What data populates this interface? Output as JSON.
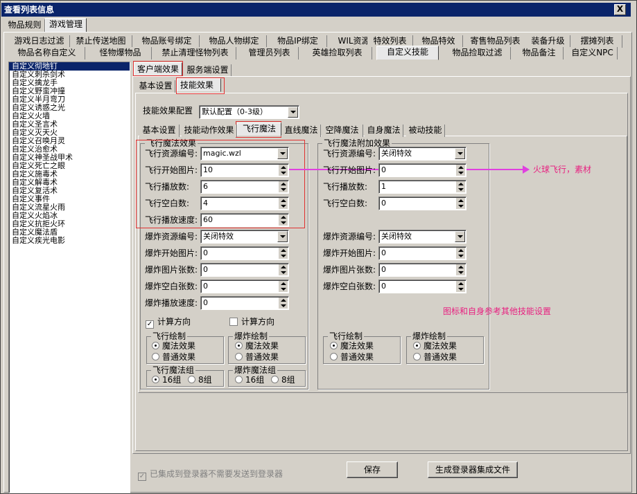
{
  "window": {
    "title": "查看列表信息",
    "close": "X"
  },
  "top_tabs": [
    "物品规则",
    "游戏管理"
  ],
  "tabs_row1": [
    "游戏日志过滤",
    "禁止传送地图",
    "物品账号绑定",
    "物品人物绑定",
    "物品IP绑定",
    "WIL资源",
    "特效列表",
    "物品特效",
    "寄售物品列表",
    "装备升级",
    "摆摊列表"
  ],
  "tabs_row2": [
    "物品名称自定义",
    "怪物爆物品",
    "禁止清理怪物列表",
    "管理员列表",
    "英雄捡取列表",
    "自定义技能",
    "物品捡取过滤",
    "物品备注",
    "自定义NPC"
  ],
  "skill_list": [
    "自定义彻地钉",
    "自定义刺杀剑术",
    "自定义擒龙手",
    "自定义野蛮冲撞",
    "自定义半月弯刀",
    "自定义诱惑之光",
    "自定义火墙",
    "自定义圣言术",
    "自定义灭天火",
    "自定义召唤月灵",
    "自定义治愈术",
    "自定义神圣战甲术",
    "自定义死亡之眼",
    "自定义施毒术",
    "自定义解毒术",
    "自定义复活术",
    "自定义事件",
    "自定义流星火雨",
    "自定义火焰冰",
    "自定义抗拒火环",
    "自定义魔法盾",
    "自定义疾光电影"
  ],
  "client_tabs": [
    "客户端效果",
    "服务端设置"
  ],
  "sub_tabs": [
    "基本设置",
    "技能效果"
  ],
  "config": {
    "label": "技能效果配置",
    "value": "默认配置（0-3级）"
  },
  "magic_tabs": [
    "基本设置",
    "技能动作效果",
    "飞行魔法",
    "直线魔法",
    "空降魔法",
    "自身魔法",
    "被动技能"
  ],
  "left": {
    "title": "飞行魔法效果",
    "fields": [
      {
        "label": "飞行资源编号:",
        "value": "magic.wzl",
        "kind": "combo"
      },
      {
        "label": "飞行开始图片:",
        "value": "10",
        "kind": "spin"
      },
      {
        "label": "飞行播放数:",
        "value": "6",
        "kind": "spin"
      },
      {
        "label": "飞行空白数:",
        "value": "4",
        "kind": "spin"
      },
      {
        "label": "飞行播放速度:",
        "value": "60",
        "kind": "spin"
      },
      {
        "label": "爆炸资源编号:",
        "value": "关闭特效",
        "kind": "combo"
      },
      {
        "label": "爆炸开始图片:",
        "value": "0",
        "kind": "spin"
      },
      {
        "label": "爆炸图片张数:",
        "value": "0",
        "kind": "spin"
      },
      {
        "label": "爆炸空白张数:",
        "value": "0",
        "kind": "spin"
      },
      {
        "label": "爆炸播放速度:",
        "value": "0",
        "kind": "spin"
      }
    ],
    "calc_direction": "计算方向"
  },
  "right": {
    "title": "飞行魔法附加效果",
    "fields": [
      {
        "label": "飞行资源编号:",
        "value": "关闭特效",
        "kind": "combo"
      },
      {
        "label": "飞行开始图片:",
        "value": "0",
        "kind": "spin"
      },
      {
        "label": "飞行播放数:",
        "value": "1",
        "kind": "spin"
      },
      {
        "label": "飞行空白数:",
        "value": "0",
        "kind": "spin"
      },
      {
        "label": "爆炸资源编号:",
        "value": "关闭特效",
        "kind": "combo"
      },
      {
        "label": "爆炸开始图片:",
        "value": "0",
        "kind": "spin"
      },
      {
        "label": "爆炸图片张数:",
        "value": "0",
        "kind": "spin"
      },
      {
        "label": "爆炸空白张数:",
        "value": "0",
        "kind": "spin"
      }
    ],
    "calc_direction": "计算方向"
  },
  "groups": {
    "fly_draw": "飞行绘制",
    "boom_draw": "爆炸绘制",
    "magic_effect": "魔法效果",
    "normal_effect": "普通效果",
    "fly_group": "飞行魔法组",
    "boom_group": "爆炸魔法组",
    "g16": "16组",
    "g8": "8组"
  },
  "notes": {
    "fire": "火球飞行，素材",
    "icon": "图标和自身参考其他技能设置"
  },
  "footer": {
    "integrated": "已集成到登录器不需要发送到登录器",
    "save": "保存",
    "generate": "生成登录器集成文件"
  }
}
